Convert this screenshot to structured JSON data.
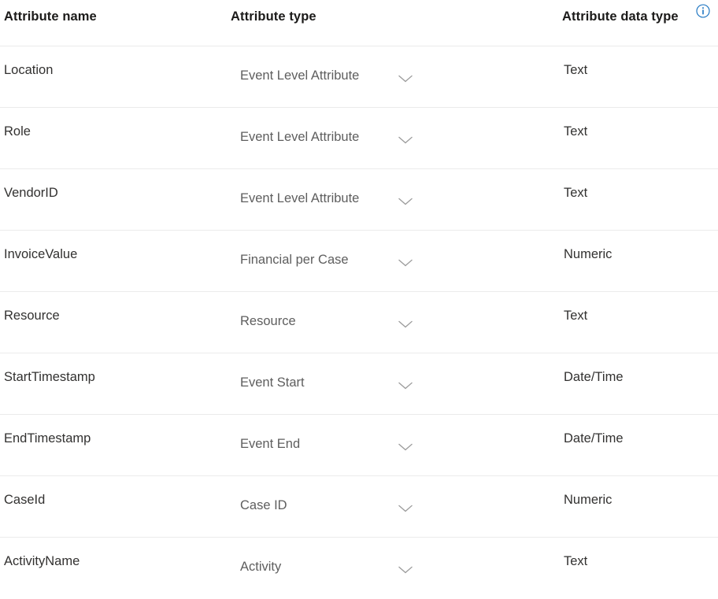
{
  "table": {
    "columns": {
      "name_header": "Attribute name",
      "type_header": "Attribute type",
      "data_type_header": "Attribute data type"
    },
    "info_icon_name": "info-icon",
    "colors": {
      "info_icon": "#0f6cbd",
      "separator": "#ebebeb",
      "header_text": "#1b1a19",
      "cell_text": "#323130",
      "dropdown_text": "#5e5e5e",
      "background": "#ffffff"
    },
    "rows": [
      {
        "name": "Location",
        "type": "Event Level Attribute",
        "data_type": "Text"
      },
      {
        "name": "Role",
        "type": "Event Level Attribute",
        "data_type": "Text"
      },
      {
        "name": "VendorID",
        "type": "Event Level Attribute",
        "data_type": "Text"
      },
      {
        "name": "InvoiceValue",
        "type": "Financial per Case",
        "data_type": "Numeric"
      },
      {
        "name": "Resource",
        "type": "Resource",
        "data_type": "Text"
      },
      {
        "name": "StartTimestamp",
        "type": "Event Start",
        "data_type": "Date/Time"
      },
      {
        "name": "EndTimestamp",
        "type": "Event End",
        "data_type": "Date/Time"
      },
      {
        "name": "CaseId",
        "type": "Case ID",
        "data_type": "Numeric"
      },
      {
        "name": "ActivityName",
        "type": "Activity",
        "data_type": "Text"
      }
    ]
  }
}
